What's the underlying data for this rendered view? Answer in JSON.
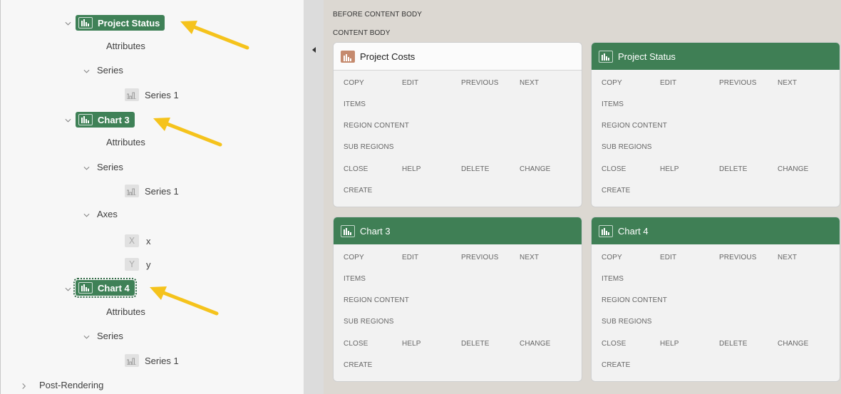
{
  "tree": {
    "project_status": "Project Status",
    "ps_attributes": "Attributes",
    "ps_series": "Series",
    "ps_series1": "Series 1",
    "chart3": "Chart 3",
    "c3_attributes": "Attributes",
    "c3_series": "Series",
    "c3_series1": "Series 1",
    "c3_axes": "Axes",
    "c3_axis_x": "x",
    "c3_axis_x_icon": "X",
    "c3_axis_y": "y",
    "c3_axis_y_icon": "Y",
    "chart4": "Chart 4",
    "c4_attributes": "Attributes",
    "c4_series": "Series",
    "c4_series1": "Series 1",
    "post_rendering": "Post-Rendering"
  },
  "canvas": {
    "before_content_body": "BEFORE CONTENT BODY",
    "content_body": "CONTENT BODY"
  },
  "positions": {
    "copy": "COPY",
    "edit": "EDIT",
    "previous": "PREVIOUS",
    "next": "NEXT",
    "items": "ITEMS",
    "region_content": "REGION CONTENT",
    "sub_regions": "SUB REGIONS",
    "close": "CLOSE",
    "help": "HELP",
    "delete": "DELETE",
    "change": "CHANGE",
    "create": "CREATE"
  },
  "cards": [
    {
      "title": "Project Costs",
      "style": "plain",
      "icon_color": "#c58a6e"
    },
    {
      "title": "Project Status",
      "style": "green"
    },
    {
      "title": "Chart 3",
      "style": "green"
    },
    {
      "title": "Chart 4",
      "style": "green"
    }
  ],
  "colors": {
    "selected_green": "#3f8157",
    "header_green": "#3f7f55",
    "arrow_yellow": "#f5c31c",
    "canvas_bg": "#dcd8d2"
  },
  "icons": {
    "chart_region": "bar-chart-icon",
    "series": "series-icon",
    "expand": "chevron-down-icon",
    "collapsed": "chevron-right-icon",
    "callout": "yellow-arrow-icon"
  }
}
